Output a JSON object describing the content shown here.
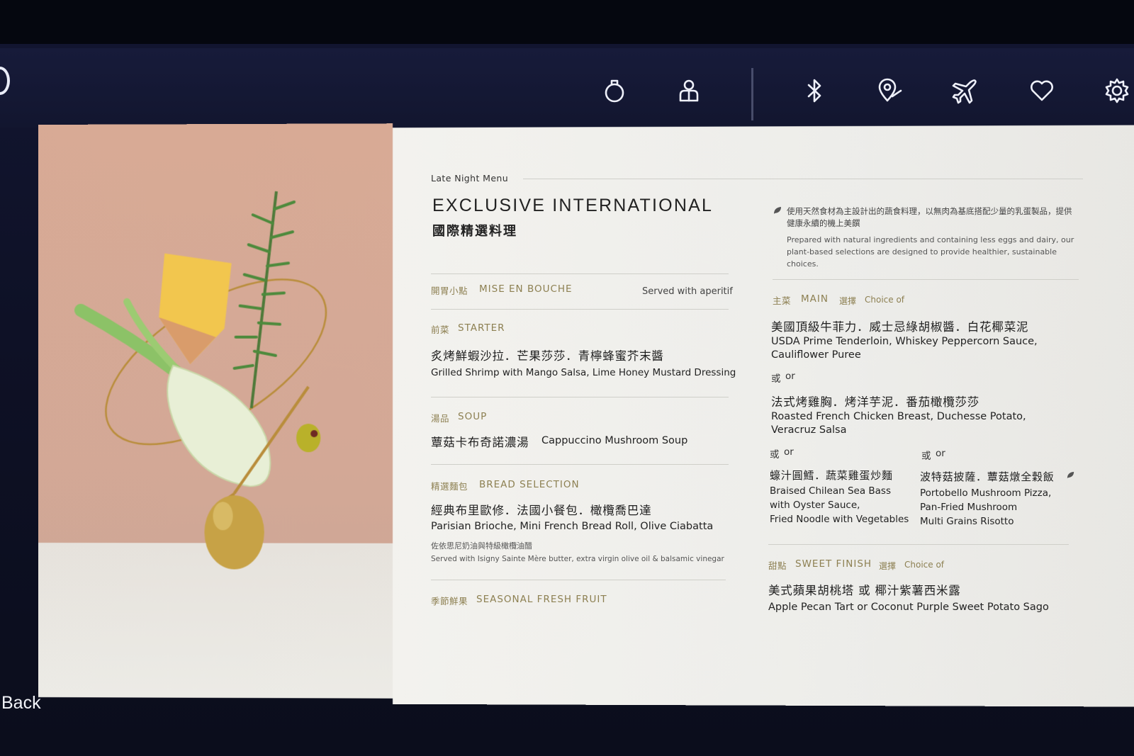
{
  "nav": {
    "back_label": "Back",
    "icons": [
      "bulb-icon",
      "person-icon",
      "bluetooth-icon",
      "map-pin-icon",
      "airplane-icon",
      "heart-icon",
      "settings-icon"
    ]
  },
  "menu": {
    "eyebrow": "Late Night Menu",
    "title_en": "EXCLUSIVE INTERNATIONAL",
    "title_zh": "國際精選料理",
    "note_zh": "使用天然食材為主設計出的蔬食料理，以無肉為基底搭配少量的乳蛋製品，提供健康永續的機上美饌",
    "note_en": "Prepared with natural ingredients and containing less eggs and dairy, our plant-based selections are designed to provide healthier, sustainable choices.",
    "mise": {
      "zh": "開胃小點",
      "en": "MISE EN BOUCHE",
      "note": "Served with aperitif"
    },
    "starter": {
      "zh": "前菜",
      "en": "STARTER",
      "dish_zh": "炙烤鮮蝦沙拉．芒果莎莎．青檸蜂蜜芥末醬",
      "dish_en": "Grilled Shrimp with Mango Salsa, Lime Honey Mustard Dressing"
    },
    "soup": {
      "zh": "湯品",
      "en": "SOUP",
      "dish_zh": "蕈菇卡布奇諾濃湯",
      "dish_en": "Cappuccino Mushroom Soup"
    },
    "bread": {
      "zh": "精選麵包",
      "en": "BREAD SELECTION",
      "dish_zh": "經典布里歐修．法國小餐包．橄欖喬巴達",
      "dish_en": "Parisian Brioche, Mini French Bread Roll, Olive Ciabatta",
      "served_zh": "佐依思尼奶油與特級橄欖油醋",
      "served_en": "Served with Isigny Sainte Mère butter, extra virgin olive oil & balsamic vinegar"
    },
    "fruit": {
      "zh": "季節鮮果",
      "en": "SEASONAL FRESH FRUIT"
    },
    "main": {
      "zh": "主菜",
      "en": "MAIN",
      "choice_zh": "選擇",
      "choice_en": "Choice of",
      "or_zh": "或",
      "or_en": "or",
      "beef_zh": "美國頂級牛菲力．威士忌綠胡椒醬．白花椰菜泥",
      "beef_en_1": "USDA Prime Tenderloin, Whiskey Peppercorn Sauce,",
      "beef_en_2": "Cauliflower Puree",
      "chicken_zh": "法式烤雞胸．烤洋芋泥．番茄橄欖莎莎",
      "chicken_en_1": "Roasted French Chicken Breast, Duchesse Potato,",
      "chicken_en_2": "Veracruz Salsa",
      "bass_zh": "蠔汁圓鱈．蔬菜雞蛋炒麵",
      "bass_en_1": "Braised Chilean Sea Bass",
      "bass_en_2": "with Oyster Sauce,",
      "bass_en_3": "Fried Noodle with Vegetables",
      "pizza_zh": "波特菇披薩．蕈菇燉全穀飯",
      "pizza_en_1": "Portobello Mushroom Pizza,",
      "pizza_en_2": "Pan-Fried Mushroom",
      "pizza_en_3": "Multi Grains Risotto"
    },
    "sweet": {
      "zh": "甜點",
      "en": "SWEET FINISH",
      "choice_zh": "選擇",
      "choice_en": "Choice of",
      "dish_zh": "美式蘋果胡桃塔 或 椰汁紫薯西米露",
      "dish_en": "Apple Pecan Tart or Coconut Purple Sweet Potato Sago"
    }
  }
}
